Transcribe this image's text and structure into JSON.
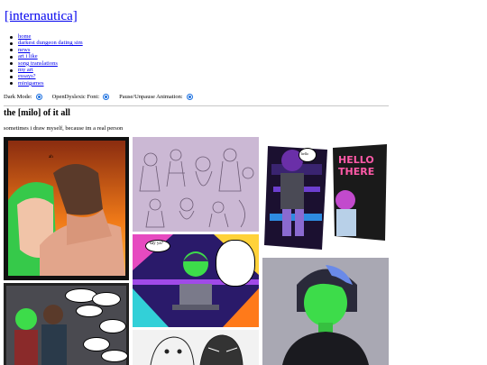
{
  "site": {
    "title": "[internautica]"
  },
  "nav": {
    "items": [
      {
        "label": "home"
      },
      {
        "label": "darkest dungeon dating sim"
      },
      {
        "label": "news"
      },
      {
        "label": "art i like"
      },
      {
        "label": "song translations"
      },
      {
        "label": "my art"
      },
      {
        "label": "essays?"
      },
      {
        "label": "minigames"
      }
    ]
  },
  "toggles": {
    "dark_mode": "Dark Mode:",
    "dyslexic_font": "OpenDyslexic Font:",
    "animation": "Pause/Unpause Animation:"
  },
  "page": {
    "heading": "the [milo] of it all",
    "subtitle": "sometimes i draw myself, because im a real person"
  },
  "gallery": {
    "comic_small_text": "ah",
    "sketch_bubble": "say ya?",
    "sticker_bubble": "hello",
    "hello_sign": [
      "HELLO",
      "THERE"
    ]
  },
  "colors": {
    "link": "#0000ee",
    "accent": "#1a6fe0",
    "milo_green": "#3ddc4a",
    "purple_bg": "#c9b3d9"
  }
}
